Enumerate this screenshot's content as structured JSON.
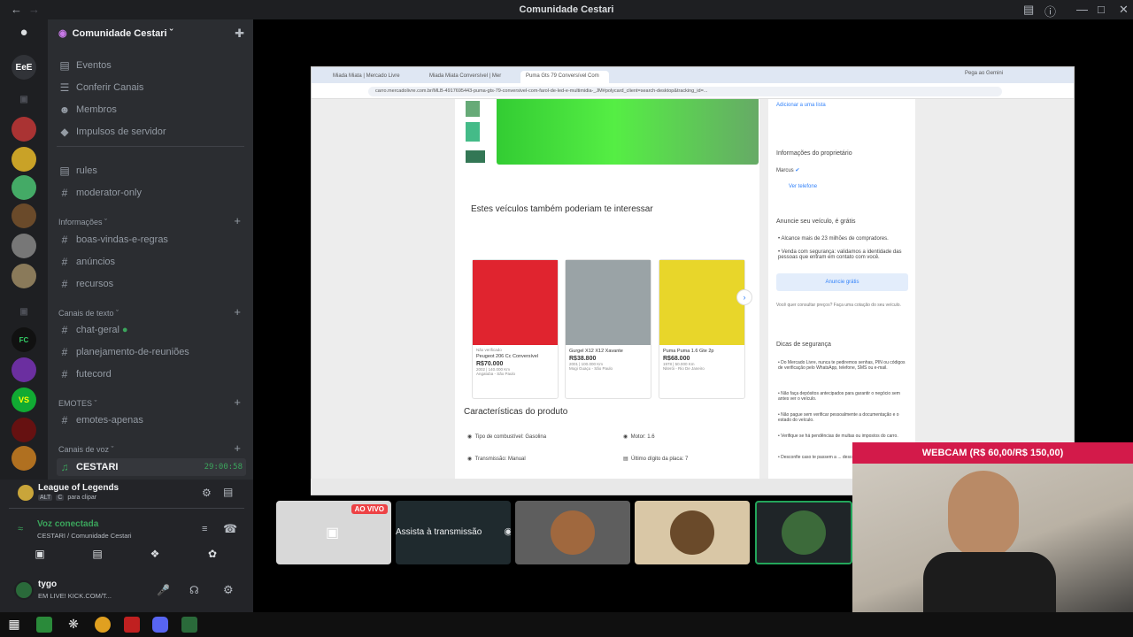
{
  "window": {
    "title": "Comunidade Cestari"
  },
  "server": {
    "name": "Comunidade Cestari",
    "top_items": [
      {
        "icon": "calendar-icon",
        "label": "Eventos"
      },
      {
        "icon": "channels-icon",
        "label": "Conferir Canais"
      },
      {
        "icon": "members-icon",
        "label": "Membros"
      },
      {
        "icon": "boost-icon",
        "label": "Impulsos de servidor"
      }
    ],
    "channels_a": [
      {
        "icon": "rules-icon",
        "label": "rules"
      },
      {
        "icon": "hash-icon",
        "label": "moderator-only"
      }
    ],
    "category_info": "Informações",
    "channels_info": [
      {
        "label": "boas-vindas-e-regras"
      },
      {
        "label": "anúncios"
      },
      {
        "label": "recursos"
      }
    ],
    "category_text": "Canais de texto",
    "channels_text": [
      {
        "label": "chat-geral"
      },
      {
        "label": "planejamento-de-reuniões"
      },
      {
        "label": "futecord"
      }
    ],
    "category_emotes": "EMOTES",
    "channels_emotes": [
      {
        "label": "emotes-apenas"
      }
    ],
    "category_voice": "Canais de voz",
    "voice_channel": {
      "label": "CESTARI",
      "timer": "29:00:58"
    }
  },
  "activity": {
    "game": "League of Legends",
    "hint_key1": "ALT",
    "hint_key2": "C",
    "hint_text": "para clipar"
  },
  "voice": {
    "status": "Voz conectada",
    "location": "CESTARI / Comunidade Cestari"
  },
  "user": {
    "name": "tygo",
    "status": "EM LIVE! KICK.COM/T..."
  },
  "browser": {
    "tabs": [
      "Miada Miata | Mercado Livre",
      "Miada Miata Conversível | Mer",
      "Puma Gts 79 Conversível Com"
    ],
    "url": "carro.mercadolivre.com.br/MLB-4917695443-puma-gts-79-conversivel-com-farol-de-led-e-multimidia-_JM#polycard_client=search-desktop&tracking_id=...",
    "gemini": "Pega ao Gemini",
    "section_title": "Estes veículos também poderiam te interessar",
    "cards": [
      {
        "tag": "Não verificado",
        "title": "Peugeot 206 Cc Conversível",
        "price": "R$70.000",
        "sub": "2002 | 140.000 Km",
        "loc": "Angatuba - São Paulo",
        "color": "#e0242f"
      },
      {
        "tag": "",
        "title": "Gurgel X12 X12 Xavante",
        "price": "R$38.800",
        "sub": "2001 | 100.000 Km",
        "loc": "Mogi Guaçu - São Paulo",
        "color": "#9aa3a6"
      },
      {
        "tag": "",
        "title": "Puma Puma 1.6 Gte 2p",
        "price": "R$68.000",
        "sub": "1978 | 50.000 Km",
        "loc": "Niterói - Rio De Janeiro",
        "color": "#e8d62a"
      }
    ],
    "features_title": "Características do produto",
    "features": [
      {
        "label": "Tipo de combustível: Gasolina"
      },
      {
        "label": "Motor: 1.6"
      },
      {
        "label": "Transmissão: Manual"
      },
      {
        "label": "Último dígito da placa: 7"
      }
    ],
    "sidebar": {
      "add_list": "Adicionar a uma lista",
      "owner_title": "Informações do proprietário",
      "owner_name": "Marcus",
      "see_phone": "Ver telefone",
      "sell_title": "Anuncie seu veículo, é grátis",
      "sell_b1": "Alcance mais de 23 milhões de compradores.",
      "sell_b2": "Venda com segurança: validamos a identidade das pessoas que entram em contato com você.",
      "sell_button": "Anuncie grátis",
      "question": "Você quer consultar preços? Faça uma cotação do seu veículo.",
      "safety_title": "Dicas de segurança",
      "tips": [
        "Do Mercado Livre, nunca te pediremos senhas, PIN ou códigos de verificação pelo WhatsApp, telefone, SMS ou e-mail.",
        "Não faça depósitos antecipados para garantir o negócio sem antes ver o veículo.",
        "Não pague sem verificar pessoalmente a documentação e o estado do veículo.",
        "Verifique se há pendências de multas ou impostos do carro.",
        "Desconfie caso te passem a ... desconhecida para fazer a ..."
      ]
    }
  },
  "stream": {
    "live_badge": "AO VIVO",
    "watch_label": "Assista à transmissão"
  },
  "webcam": {
    "label": "WEBCAM (R$ 60,00/R$ 150,00)"
  }
}
